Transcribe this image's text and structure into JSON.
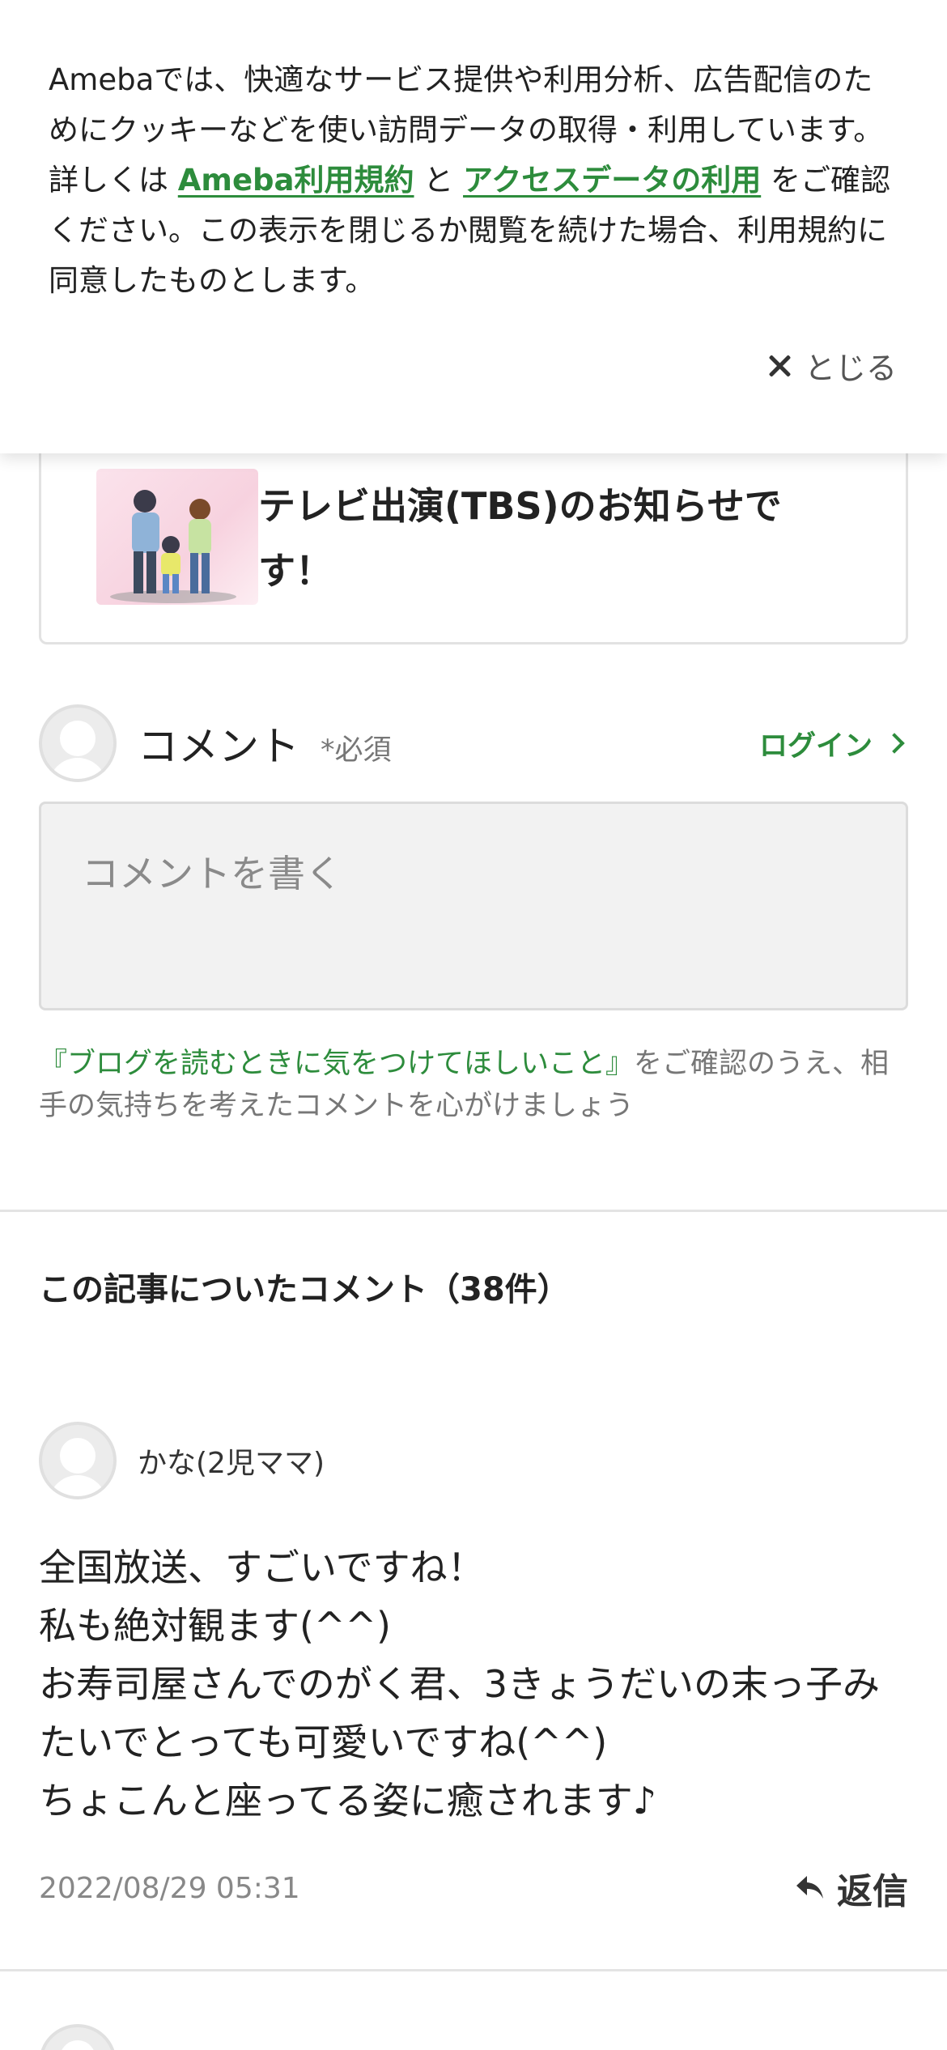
{
  "cookie_banner": {
    "text_before": "Amebaでは、快適なサービス提供や利用分析、広告配信のためにクッキーなどを使い訪問データの取得・利用しています。詳しくは ",
    "link_terms": "Ameba利用規約",
    "text_middle": " と ",
    "link_access": "アクセスデータの利用",
    "text_after": " をご確認ください。この表示を閉じるか閲覧を続けた場合、利用規約に同意したものとします。",
    "close_label": "とじる"
  },
  "article_card": {
    "title": "テレビ出演(TBS)のお知らせです！"
  },
  "comment_form": {
    "label": "コメント",
    "required": "*必須",
    "login_label": "ログイン",
    "placeholder": "コメントを書く",
    "guideline_link": "『ブログを読むときに気をつけてほしいこと』",
    "guideline_text": "をご確認のうえ、相手の気持ちを考えたコメントを心がけましょう"
  },
  "comments": {
    "heading": "この記事についたコメント（38件）",
    "items": [
      {
        "author": "かな(2児ママ)",
        "lines": [
          "全国放送、すごいですね！",
          "私も絶対観ます(^^)",
          "お寿司屋さんでのがく君、3きょうだいの末っ子みたいでとっても可愛いですね(^^)",
          "ちょこんと座ってる姿に癒されます♪"
        ],
        "date": "2022/08/29 05:31",
        "reply_label": "返信"
      }
    ]
  },
  "colors": {
    "accent_green": "#2d8c3c",
    "text_dark": "#222222",
    "text_muted": "#888888"
  }
}
